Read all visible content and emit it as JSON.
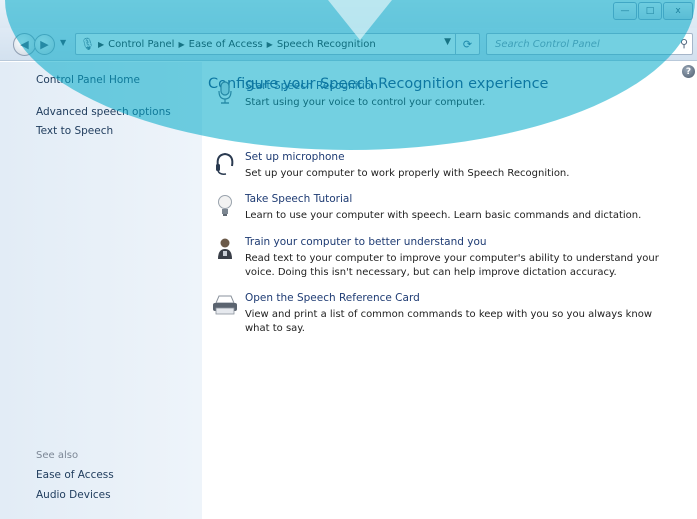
{
  "window": {
    "minimize_label": "—",
    "maximize_label": "□",
    "close_label": "x"
  },
  "navbar": {
    "breadcrumbs": [
      "Control Panel",
      "Ease of Access",
      "Speech Recognition"
    ],
    "search_placeholder": "Search Control Panel"
  },
  "sidebar": {
    "home": "Control Panel Home",
    "items": [
      "Advanced speech options",
      "Text to Speech"
    ],
    "see_also_heading": "See also",
    "see_also_items": [
      "Ease of Access",
      "Audio Devices"
    ]
  },
  "main": {
    "title": "Configure your Speech Recognition experience",
    "tasks": [
      {
        "icon": "microphone-icon",
        "link": "Start Speech Recognition",
        "desc": "Start using your voice to control your computer."
      },
      {
        "icon": "headset-icon",
        "link": "Set up microphone",
        "desc": "Set up your computer to work properly with Speech Recognition."
      },
      {
        "icon": "lightbulb-icon",
        "link": "Take Speech Tutorial",
        "desc": "Learn to use your computer with speech.  Learn basic commands and dictation."
      },
      {
        "icon": "speaker-person-icon",
        "link": "Train your computer to better understand you",
        "desc": "Read text to your computer to improve your computer's ability to understand your voice. Doing this isn't necessary, but can help improve dictation accuracy."
      },
      {
        "icon": "printer-icon",
        "link": "Open the Speech Reference Card",
        "desc": "View and print a list of common commands to keep with you so you always know what to say."
      }
    ]
  },
  "colors": {
    "link": "#1e3b73",
    "watermark": "#00aac8"
  }
}
